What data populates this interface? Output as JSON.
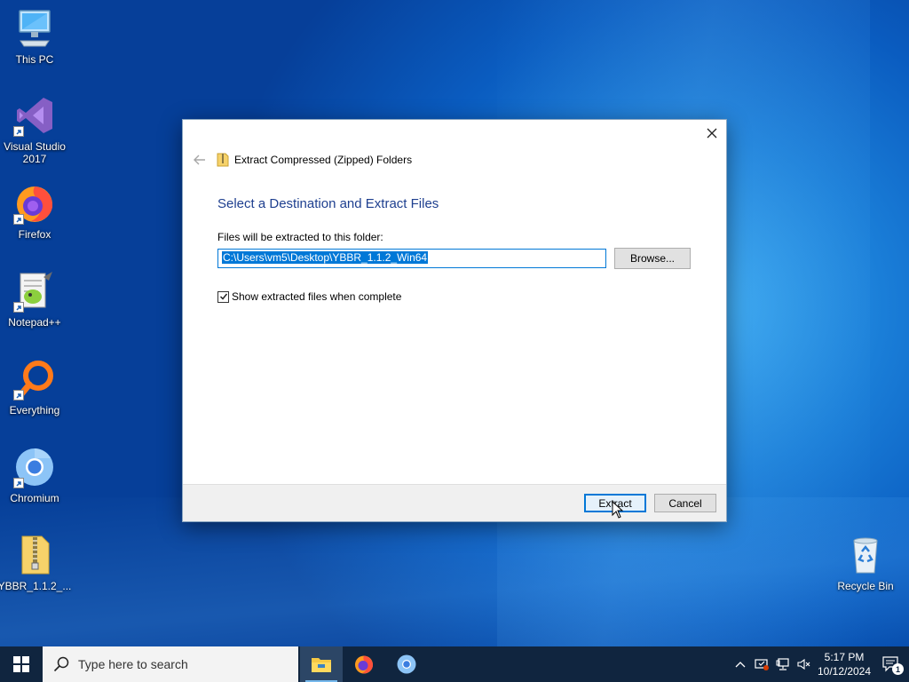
{
  "desktop": {
    "icons": [
      {
        "label": "This PC"
      },
      {
        "label": "Visual Studio 2017"
      },
      {
        "label": "Firefox"
      },
      {
        "label": "Notepad++"
      },
      {
        "label": "Everything"
      },
      {
        "label": "Chromium"
      },
      {
        "label": "YBBR_1.1.2_..."
      },
      {
        "label": "Recycle Bin"
      }
    ]
  },
  "dialog": {
    "title": "Extract Compressed (Zipped) Folders",
    "heading": "Select a Destination and Extract Files",
    "path_label": "Files will be extracted to this folder:",
    "path_value": "C:\\Users\\vm5\\Desktop\\YBBR_1.1.2_Win64",
    "browse_label": "Browse...",
    "show_files_label": "Show extracted files when complete",
    "show_files_checked": true,
    "extract_label": "Extract",
    "cancel_label": "Cancel"
  },
  "taskbar": {
    "search_placeholder": "Type here to search",
    "apps": [
      "file-explorer-icon",
      "firefox-icon",
      "chromium-icon"
    ],
    "time": "5:17 PM",
    "date": "10/12/2024",
    "notification_count": "1"
  },
  "colors": {
    "accent": "#0078d7",
    "heading": "#1e3f8f",
    "taskbar": "#10253f"
  }
}
